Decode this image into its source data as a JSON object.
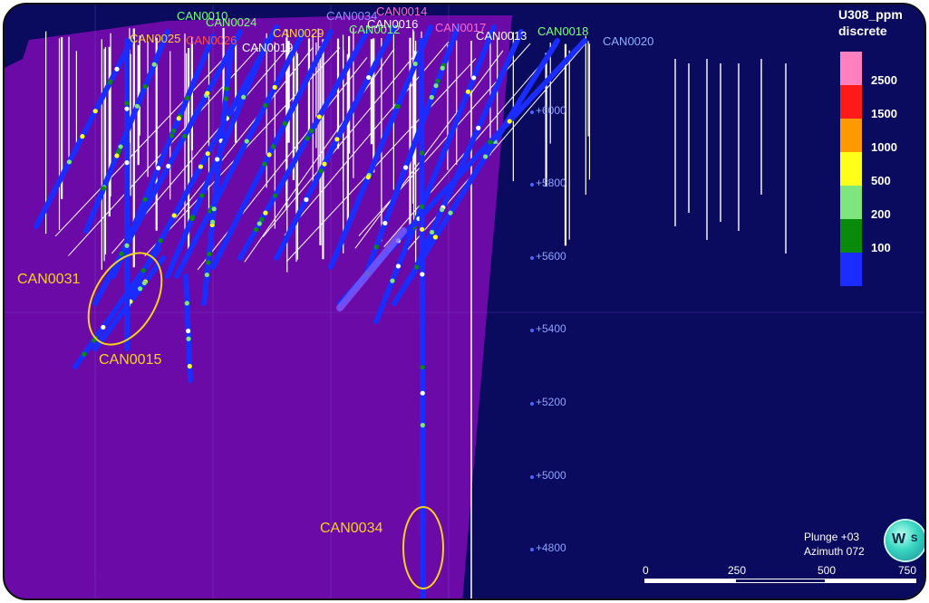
{
  "colors": {
    "background": "#0a0a5e",
    "section_fill": "#6b0aa6",
    "hole_trace": "#1a2cff",
    "collar_line": "#ffffff",
    "callout": "#f5d21b",
    "elevation_text": "#8fa3ff"
  },
  "hole_labels": [
    {
      "text": "CAN0010",
      "color": "#7dff7d"
    },
    {
      "text": "CAN0024",
      "color": "#7dff7d"
    },
    {
      "text": "CAN0034",
      "color": "#8f8fff"
    },
    {
      "text": "CAN0014",
      "color": "#ff6ad0"
    },
    {
      "text": "CAN0016",
      "color": "#ffffff"
    },
    {
      "text": "CAN0017",
      "color": "#ff6ad0"
    },
    {
      "text": "CAN0018",
      "color": "#7dff7d"
    },
    {
      "text": "CAN0020",
      "color": "#8fb0ff"
    },
    {
      "text": "CAN0025",
      "color": "#ffd23c"
    },
    {
      "text": "CAN0026",
      "color": "#ff5050"
    },
    {
      "text": "CAN0019",
      "color": "#ffffff"
    },
    {
      "text": "CAN0013",
      "color": "#ffffff"
    },
    {
      "text": "CAN0029",
      "color": "#ffd23c"
    },
    {
      "text": "CAN0012",
      "color": "#7dff7d"
    }
  ],
  "callouts": {
    "can0031": "CAN0031",
    "can0015": "CAN0015",
    "can0034": "CAN0034"
  },
  "elevations": [
    "+6000",
    "+5800",
    "+5600",
    "+5400",
    "+5200",
    "+5000",
    "+4800"
  ],
  "legend": {
    "title_line1": "U308_ppm",
    "title_line2": "discrete",
    "entries": [
      {
        "label": "2500",
        "color": "#ff7fbf"
      },
      {
        "label": "1500",
        "color": "#ff1a1a"
      },
      {
        "label": "1000",
        "color": "#ff9900"
      },
      {
        "label": "500",
        "color": "#ffff1a"
      },
      {
        "label": "200",
        "color": "#7fe57f"
      },
      {
        "label": "100",
        "color": "#0a8a0a"
      },
      {
        "label": "",
        "color": "#1a2cff"
      }
    ]
  },
  "view": {
    "plunge": "Plunge +03",
    "azimuth": "Azimuth 072",
    "compass_w": "W",
    "compass_s": "S"
  },
  "scalebar": {
    "labels": [
      "0",
      "250",
      "500",
      "750"
    ]
  }
}
